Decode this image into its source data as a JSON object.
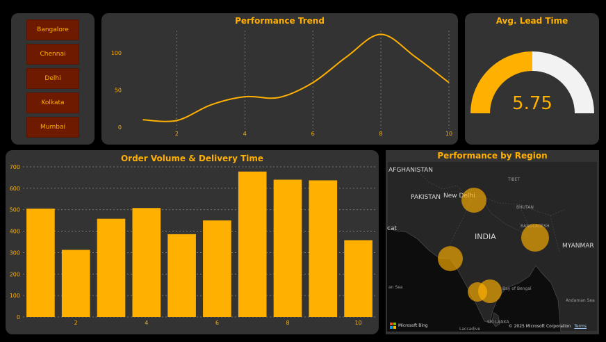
{
  "colors": {
    "accent": "#FFB000",
    "panel": "#333333",
    "button_bg": "#6E1A00",
    "gauge_remaining": "#F2F2F2"
  },
  "slicer": {
    "items": [
      "Bangalore",
      "Chennai",
      "Delhi",
      "Kolkata",
      "Mumbai"
    ]
  },
  "trend": {
    "title": "Performance Trend"
  },
  "gauge": {
    "title": "Avg. Lead Time",
    "value_label": "5.75",
    "fraction": 0.5
  },
  "volume": {
    "title": "Order Volume & Delivery Time"
  },
  "map": {
    "title": "Performance by Region",
    "labels": {
      "afghanistan": "AFGHANISTAN",
      "pakistan": "PAKISTAN",
      "new_delhi": "New Delhi",
      "tibet": "TIBET",
      "bhutan": "BHUTAN",
      "bangladesh": "BANGLADESH",
      "india": "INDIA",
      "myanmar": "MYANMAR",
      "sri_lanka": "SRI LANKA",
      "bay_of_bengal": "Bay of Bengal",
      "andaman_sea": "Andaman Sea",
      "arabian_sea": "an Sea",
      "cat": "cat",
      "laccadive": "Laccadive"
    },
    "bing_label": "Microsoft Bing",
    "copyright": "© 2025 Microsoft Corporation",
    "terms": "Terms"
  },
  "chart_data": [
    {
      "type": "line",
      "title": "Performance Trend",
      "x": [
        1,
        2,
        3,
        4,
        5,
        6,
        7,
        8,
        9,
        10
      ],
      "series": [
        {
          "values": [
            10,
            9,
            30,
            41,
            40,
            60,
            95,
            125,
            95,
            60
          ]
        }
      ],
      "xticks": [
        2,
        4,
        6,
        8,
        10
      ],
      "yticks": [
        0,
        50,
        100
      ],
      "xlim": [
        0.5,
        10
      ],
      "ylim": [
        0,
        130
      ],
      "grid": "vertical dotted"
    },
    {
      "type": "bar",
      "title": "Order Volume & Delivery Time",
      "x": [
        1,
        2,
        3,
        4,
        5,
        6,
        7,
        8,
        9,
        10
      ],
      "values": [
        505,
        313,
        458,
        508,
        386,
        450,
        678,
        640,
        637,
        358
      ],
      "xticks": [
        2,
        4,
        6,
        8,
        10
      ],
      "yticks": [
        0,
        100,
        200,
        300,
        400,
        500,
        600,
        700
      ],
      "ylim": [
        0,
        700
      ],
      "grid": "horizontal dotted"
    }
  ]
}
